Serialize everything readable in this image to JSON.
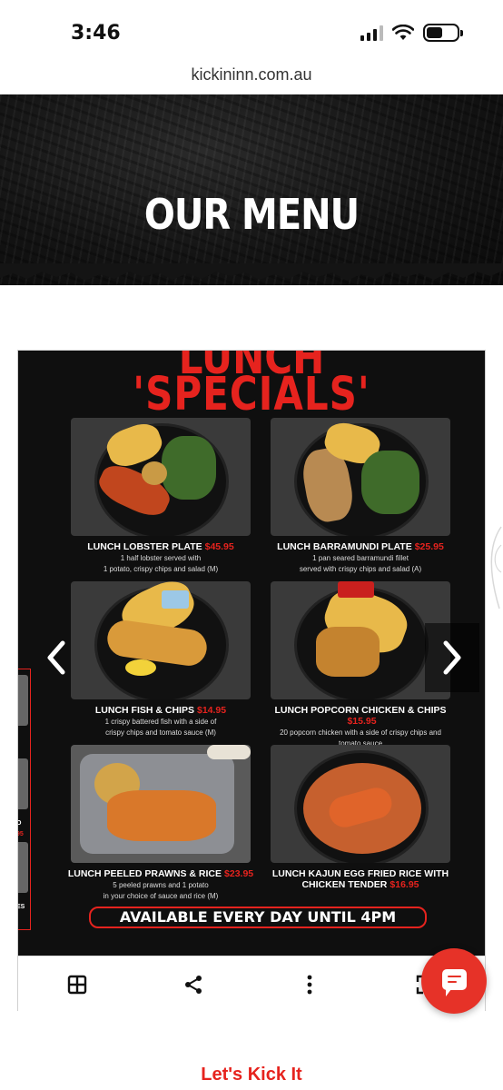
{
  "status": {
    "time": "3:46"
  },
  "browser": {
    "url": "kickininn.com.au"
  },
  "hero": {
    "title": "OUR MENU"
  },
  "menu": {
    "heading_line1": "LUNCH",
    "heading_line2": "'SPECIALS'",
    "items": [
      {
        "name": "LUNCH LOBSTER PLATE",
        "price": "$45.95",
        "desc1": "1 half lobster served with",
        "desc2": "1 potato, crispy chips and salad (M)"
      },
      {
        "name": "LUNCH BARRAMUNDI PLATE",
        "price": "$25.95",
        "desc1": "1 pan seared barramundi fillet",
        "desc2": "served with crispy chips and salad (A)"
      },
      {
        "name": "LUNCH FISH & CHIPS",
        "price": "$14.95",
        "desc1": "1 crispy battered fish with a side of",
        "desc2": "crispy chips and tomato sauce (M)"
      },
      {
        "name": "LUNCH POPCORN CHICKEN & CHIPS",
        "price": "$15.95",
        "desc1": "20 popcorn chicken with a side of crispy chips and",
        "desc2": "tomato sauce"
      },
      {
        "name": "LUNCH PEELED PRAWNS & RICE",
        "price": "$23.95",
        "desc1": "5 peeled prawns and 1 potato",
        "desc2": "in your choice of sauce and rice (M)"
      },
      {
        "name": "LUNCH KAJUN EGG FRIED RICE WITH",
        "name2": "CHICKEN TENDER",
        "price": "$16.95"
      }
    ],
    "available": "AVAILABLE  EVERY DAY UNTIL 4PM",
    "side_fragments": [
      "O",
      "95",
      "ES"
    ]
  },
  "carousel": {
    "prev_icon": "chevron-left-icon",
    "next_icon": "chevron-right-icon"
  },
  "toolbar": {
    "icons": [
      "grid-icon",
      "share-icon",
      "more-vertical-icon",
      "fullscreen-icon"
    ]
  },
  "chat": {
    "icon": "chat-icon",
    "color": "#e63228"
  },
  "footer": {
    "text": "Let's Kick It"
  },
  "colors": {
    "accent": "#e6231e",
    "board_bg": "#0f0f0f"
  }
}
